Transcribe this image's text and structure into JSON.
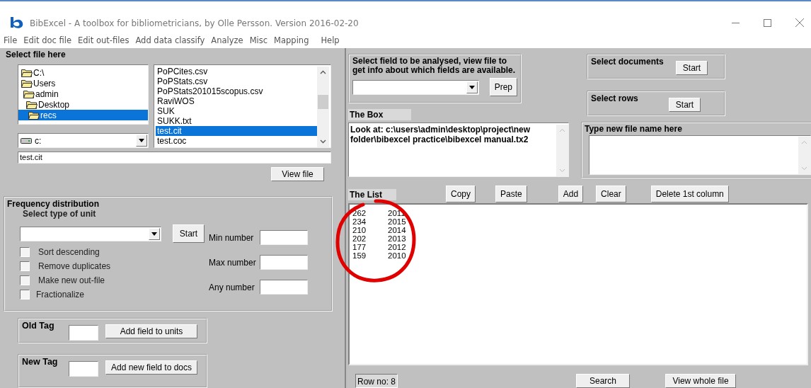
{
  "window": {
    "title": "BibExcel - A toolbox for bibliometricians, by Olle Persson. Version 2016-02-20"
  },
  "menu": [
    "File",
    "Edit doc file",
    "Edit out-files",
    "Add data classify",
    "Analyze",
    "Misc",
    "Mapping",
    "Help"
  ],
  "file_panel": {
    "title": "Select file here",
    "folders": [
      {
        "label": "C:\\",
        "selected": false,
        "children": [
          {
            "label": "Users",
            "selected": false,
            "children": [
              {
                "label": "admin",
                "selected": false,
                "children": [
                  {
                    "label": "Desktop",
                    "selected": false,
                    "children": [
                      {
                        "label": "recs",
                        "selected": true
                      }
                    ]
                  }
                ]
              }
            ]
          }
        ]
      }
    ],
    "files": [
      {
        "label": "PoPCites.csv",
        "selected": false
      },
      {
        "label": "PoPStats.csv",
        "selected": false
      },
      {
        "label": "PoPStats201015scopus.csv",
        "selected": false
      },
      {
        "label": "RaviWOS",
        "selected": false
      },
      {
        "label": "SUK",
        "selected": false
      },
      {
        "label": "SUKK.txt",
        "selected": false
      },
      {
        "label": "test.cit",
        "selected": true
      },
      {
        "label": "test.coc",
        "selected": false
      }
    ],
    "drive": "c:",
    "file_name": "test.cit",
    "view_button": "View file"
  },
  "frequency": {
    "title": "Frequency distribution",
    "unit_label": "Select type of unit",
    "start_button": "Start",
    "checkboxes": [
      {
        "label": "Sort descending",
        "checked": false
      },
      {
        "label": "Remove duplicates",
        "checked": false
      },
      {
        "label": "Make new out-file",
        "checked": false
      },
      {
        "label": "Fractionalize",
        "checked": false
      }
    ],
    "number_fields": [
      "Min number",
      "Max number",
      "Any number"
    ]
  },
  "old_tag": {
    "label": "Old Tag",
    "button": "Add field to units"
  },
  "new_tag": {
    "label": "New Tag",
    "button": "Add new field to docs"
  },
  "field_select": {
    "text": "Select field to be analysed, view file to get info about which fields are available.",
    "button": "Prep"
  },
  "select_documents": {
    "label": "Select documents",
    "button": "Start"
  },
  "select_rows": {
    "label": "Select rows",
    "button": "Start"
  },
  "the_box": {
    "title": "The Box",
    "value": "Look at: c:\\users\\admin\\desktop\\project\\new folder\\bibexcel practice\\bibexcel manual.tx2"
  },
  "new_file_name": {
    "title": "Type new file name here"
  },
  "the_list": {
    "title": "The List",
    "buttons": [
      "Copy",
      "Paste",
      "Add",
      "Clear",
      "Delete 1st column"
    ],
    "rows": [
      [
        "262",
        "2011"
      ],
      [
        "234",
        "2015"
      ],
      [
        "210",
        "2014"
      ],
      [
        "202",
        "2013"
      ],
      [
        "177",
        "2012"
      ],
      [
        "159",
        "2010"
      ]
    ]
  },
  "status": {
    "row_no": "Row no: 8",
    "buttons": [
      "Search",
      "View whole file"
    ]
  }
}
